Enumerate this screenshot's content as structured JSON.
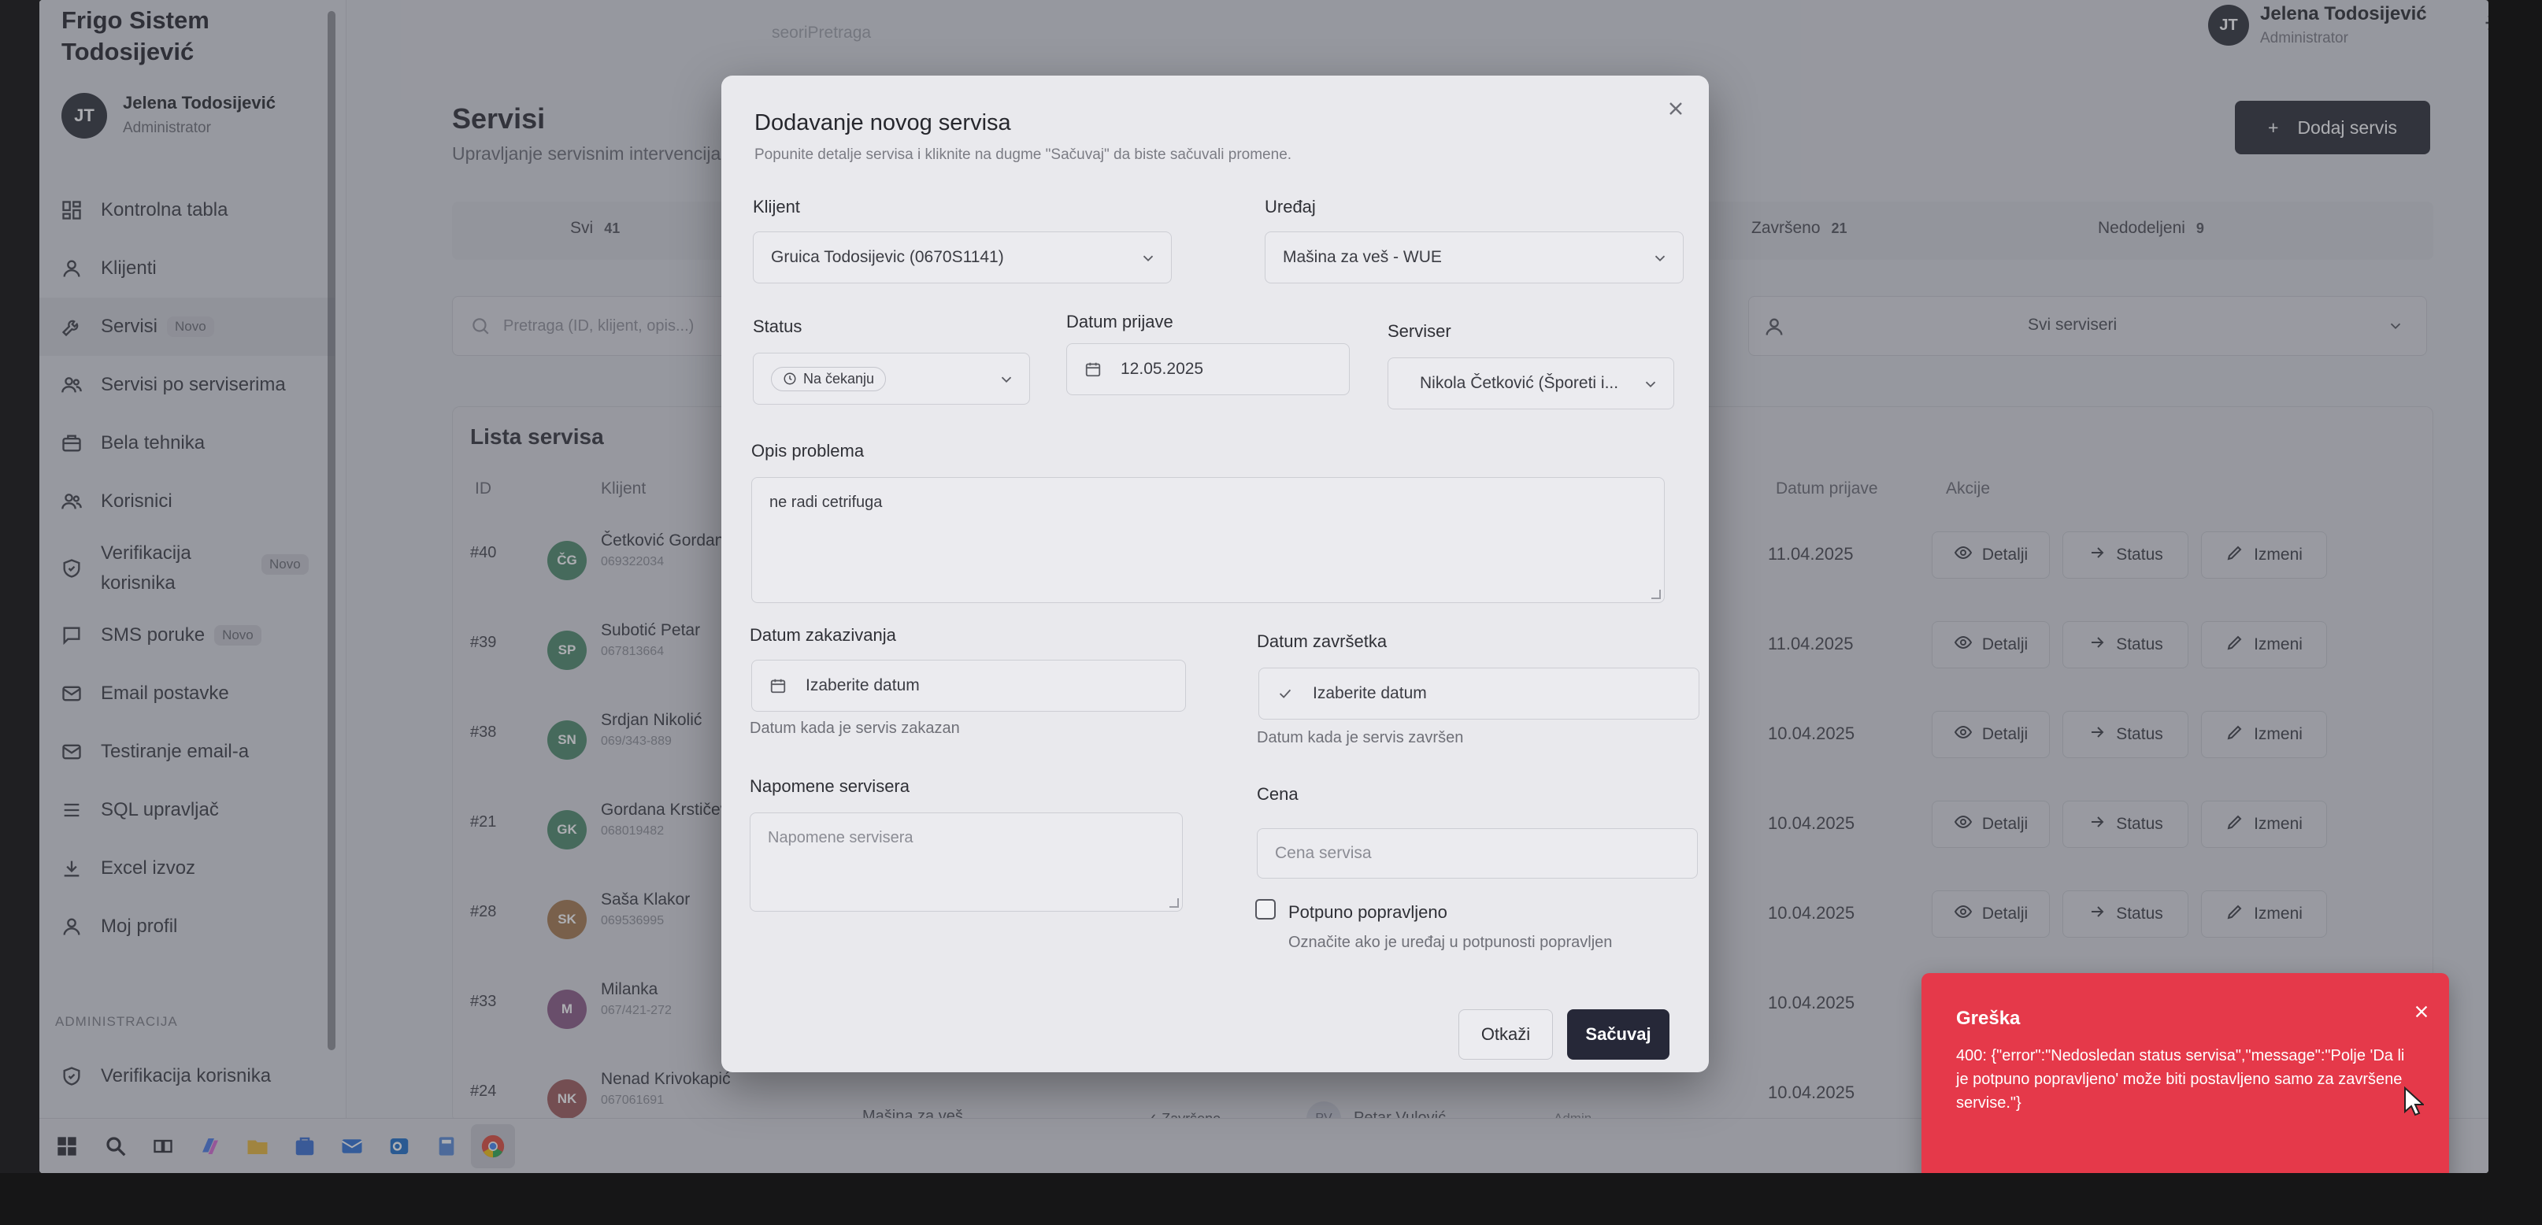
{
  "sidebar": {
    "brand": "Frigo Sistem Todosijević",
    "user": {
      "initials": "JT",
      "name": "Jelena Todosijević",
      "role": "Administrator"
    },
    "items": [
      {
        "label": "Kontrolna tabla",
        "icon": "dashboard-icon"
      },
      {
        "label": "Klijenti",
        "icon": "user-icon"
      },
      {
        "label": "Servisi",
        "icon": "wrench-icon",
        "badge": "Novo"
      },
      {
        "label": "Servisi po serviserima",
        "icon": "users-icon"
      },
      {
        "label": "Bela tehnika",
        "icon": "briefcase-icon"
      },
      {
        "label": "Korisnici",
        "icon": "users-icon"
      },
      {
        "label": "Verifikacija korisnika",
        "icon": "shield-icon",
        "badge": "Novo"
      },
      {
        "label": "SMS poruke",
        "icon": "message-icon",
        "badge": "Novo"
      },
      {
        "label": "Email postavke",
        "icon": "mail-icon"
      },
      {
        "label": "Testiranje email-a",
        "icon": "mail-icon"
      },
      {
        "label": "SQL upravljač",
        "icon": "list-icon"
      },
      {
        "label": "Excel izvoz",
        "icon": "download-icon"
      },
      {
        "label": "Moj profil",
        "icon": "user-icon"
      }
    ],
    "section_admin": "ADMINISTRACIJA",
    "admin_items": [
      {
        "label": "Verifikacija korisnika",
        "icon": "shield-icon"
      }
    ]
  },
  "header": {
    "search_placeholder": "seoriPretraga",
    "user": {
      "initials": "JT",
      "name": "Jelena Todosijević",
      "role": "Administrator"
    }
  },
  "page": {
    "title": "Servisi",
    "subtitle": "Upravljanje servisnim intervencijama",
    "add_button": "Dodaj servis",
    "tabs": [
      {
        "label": "Svi",
        "count": "41"
      },
      {
        "label": "Završeno",
        "count": "21"
      },
      {
        "label": "Nedodeljeni",
        "count": "9"
      }
    ],
    "search_placeholder": "Pretraga (ID, klijent, opis...)",
    "serviser_filter": "Svi serviseri",
    "list_title": "Lista servisa",
    "columns": {
      "id": "ID",
      "client": "Klijent",
      "date": "Datum prijave",
      "actions": "Akcije"
    },
    "action_labels": {
      "details": "Detalji",
      "status": "Status",
      "edit": "Izmeni"
    },
    "rows": [
      {
        "id": "#40",
        "initials": "ČG",
        "color": "#4f8a6b",
        "name": "Četković Gordana",
        "phone": "069322034",
        "date": "11.04.2025"
      },
      {
        "id": "#39",
        "initials": "SP",
        "color": "#4f8a6b",
        "name": "Subotić Petar",
        "phone": "067813664",
        "date": "11.04.2025"
      },
      {
        "id": "#38",
        "initials": "SN",
        "color": "#4f8a6b",
        "name": "Srdjan Nikolić",
        "phone": "069/343-889",
        "date": "10.04.2025"
      },
      {
        "id": "#21",
        "initials": "GK",
        "color": "#4f8a6b",
        "name": "Gordana Krstičević",
        "phone": "068019482",
        "date": "10.04.2025"
      },
      {
        "id": "#28",
        "initials": "SK",
        "color": "#a5794e",
        "name": "Saša Klakor",
        "phone": "069536995",
        "date": "10.04.2025"
      },
      {
        "id": "#33",
        "initials": "M",
        "color": "#8a5a86",
        "name": "Milanka",
        "phone": "067/421-272",
        "date": "10.04.2025"
      },
      {
        "id": "#24",
        "initials": "NK",
        "color": "#9e5a5a",
        "name": "Nenad Krivokapić",
        "phone": "067061691",
        "date": "10.04.2025",
        "type": "Mašina za veš",
        "status": "✓ Završeno",
        "tech_initials": "PV",
        "tech": "Petar Vulović",
        "by": "Admin"
      }
    ]
  },
  "modal": {
    "title": "Dodavanje novog servisa",
    "subtitle": "Popunite detalje servisa i kliknite na dugme \"Sačuvaj\" da biste sačuvali promene.",
    "client_label": "Klijent",
    "client_value": "Gruica Todosijevic (0670S1141)",
    "device_label": "Uređaj",
    "device_value": "Mašina za veš - WUE",
    "status_label": "Status",
    "status_value": "Na čekanju",
    "date_label": "Datum prijave",
    "date_value": "12.05.2025",
    "serviser_label": "Serviser",
    "serviser_value": "Nikola Četković (Šporeti i...",
    "problem_label": "Opis problema",
    "problem_value": "ne radi cetrifuga",
    "scheduled_label": "Datum zakazivanja",
    "scheduled_placeholder": "Izaberite datum",
    "scheduled_hint": "Datum kada je servis zakazan",
    "completed_label": "Datum završetka",
    "completed_placeholder": "Izaberite datum",
    "completed_hint": "Datum kada je servis završen",
    "notes_label": "Napomene servisera",
    "notes_placeholder": "Napomene servisera",
    "price_label": "Cena",
    "price_placeholder": "Cena servisa",
    "repaired_label": "Potpuno popravljeno",
    "repaired_hint": "Označite ako je uređaj u potpunosti popravljen",
    "cancel": "Otkaži",
    "save": "Sačuvaj"
  },
  "toast": {
    "title": "Greška",
    "message": "400: {\"error\":\"Nedosledan status servisa\",\"message\":\"Polje 'Da li je potpuno popravljeno' može biti postavljeno samo za završene servise.\"}"
  },
  "colors": {
    "primary": "#262838",
    "error": "#e5394a"
  }
}
